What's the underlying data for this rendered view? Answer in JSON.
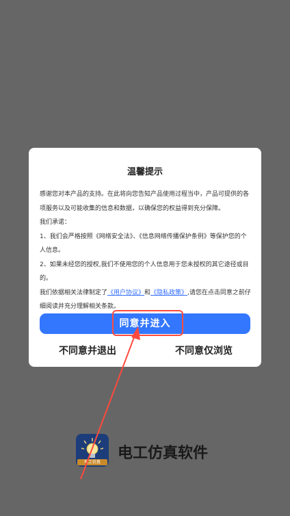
{
  "dialog": {
    "title": "温馨提示",
    "intro": "感谢您对本产品的支持。在此将向您告知产品使用过程当中，产品可提供的各项服务以及可能收集的信息和数据，以确保您的权益得到充分保障。",
    "promise_heading": "我们承诺：",
    "item1": "1、我们会严格按照《网络安全法》、《信息网络传播保护条例》等保护您的个人信息。",
    "item2": "2、如果未经您的授权,我们不使用您的个人信息用于您未授权的其它途径或目的。",
    "legal_prefix": "我们依据相关法律制定了",
    "user_agreement_link": "《用户协议》",
    "and": "和",
    "privacy_link": "《隐私政策》",
    "legal_suffix": ",请您在点击同意之前仔细阅读并充分理解相关条款。",
    "agree_button": "同意并进入",
    "exit_button": "不同意并退出",
    "browse_button": "不同意仅浏览"
  },
  "app": {
    "name": "电工仿真软件",
    "icon_label": "电工仿真"
  },
  "colors": {
    "overlay": "#666666",
    "accent": "#3377ff",
    "highlight": "#ff4a3d"
  },
  "icons": [
    "lightbulb-icon"
  ]
}
